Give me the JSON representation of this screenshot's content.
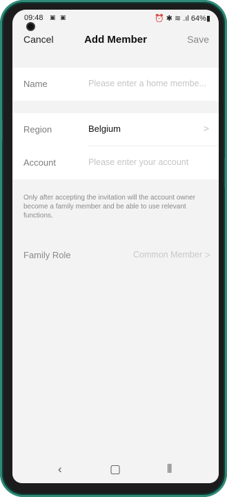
{
  "status_bar": {
    "time": "09:48",
    "left_icons": "▣ ▣",
    "right_icons": "⏰ ✱ ≋ .ıl",
    "battery_percent": "64%",
    "battery_glyph": "▮"
  },
  "header": {
    "cancel_label": "Cancel",
    "title": "Add Member",
    "save_label": "Save"
  },
  "form": {
    "name": {
      "label": "Name",
      "placeholder": "Please enter a home membe..."
    },
    "region": {
      "label": "Region",
      "value": "Belgium",
      "chevron": ">"
    },
    "account": {
      "label": "Account",
      "placeholder": "Please enter your account"
    }
  },
  "notice": "Only after accepting the invitation will the account owner become a family member and be able to use relevant functions.",
  "family_role": {
    "label": "Family Role",
    "value": "Common Member",
    "chevron": ">"
  },
  "system_nav": {
    "back": "‹",
    "home": "▢",
    "recents": "⦀"
  }
}
